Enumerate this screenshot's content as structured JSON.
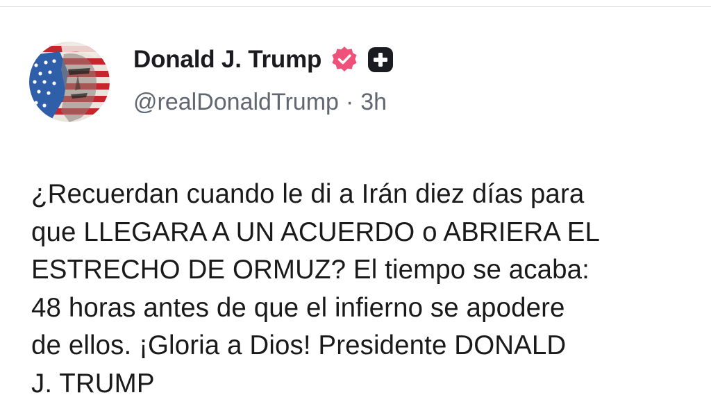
{
  "author": {
    "display_name": "Donald J. Trump",
    "handle": "@realDonaldTrump",
    "separator": "·",
    "time_ago": "3h",
    "avatar_icon": "flag-portrait-avatar",
    "verified_icon": "verified-badge-icon",
    "verified_color": "#f0517a",
    "plus_icon": "plus-badge-icon"
  },
  "post": {
    "text": "¿Recuerdan cuando le di a Irán diez días para\nque LLEGARA A UN ACUERDO o ABRIERA EL\nESTRECHO DE ORMUZ? El tiempo se acaba:\n48 horas antes de que el infierno se apodere\nde ellos. ¡Gloria a Dios! Presidente DONALD\nJ. TRUMP"
  },
  "colors": {
    "background": "#ffffff",
    "text": "#1a1a1a",
    "muted": "#606770",
    "badge_dark": "#1b1b22"
  }
}
